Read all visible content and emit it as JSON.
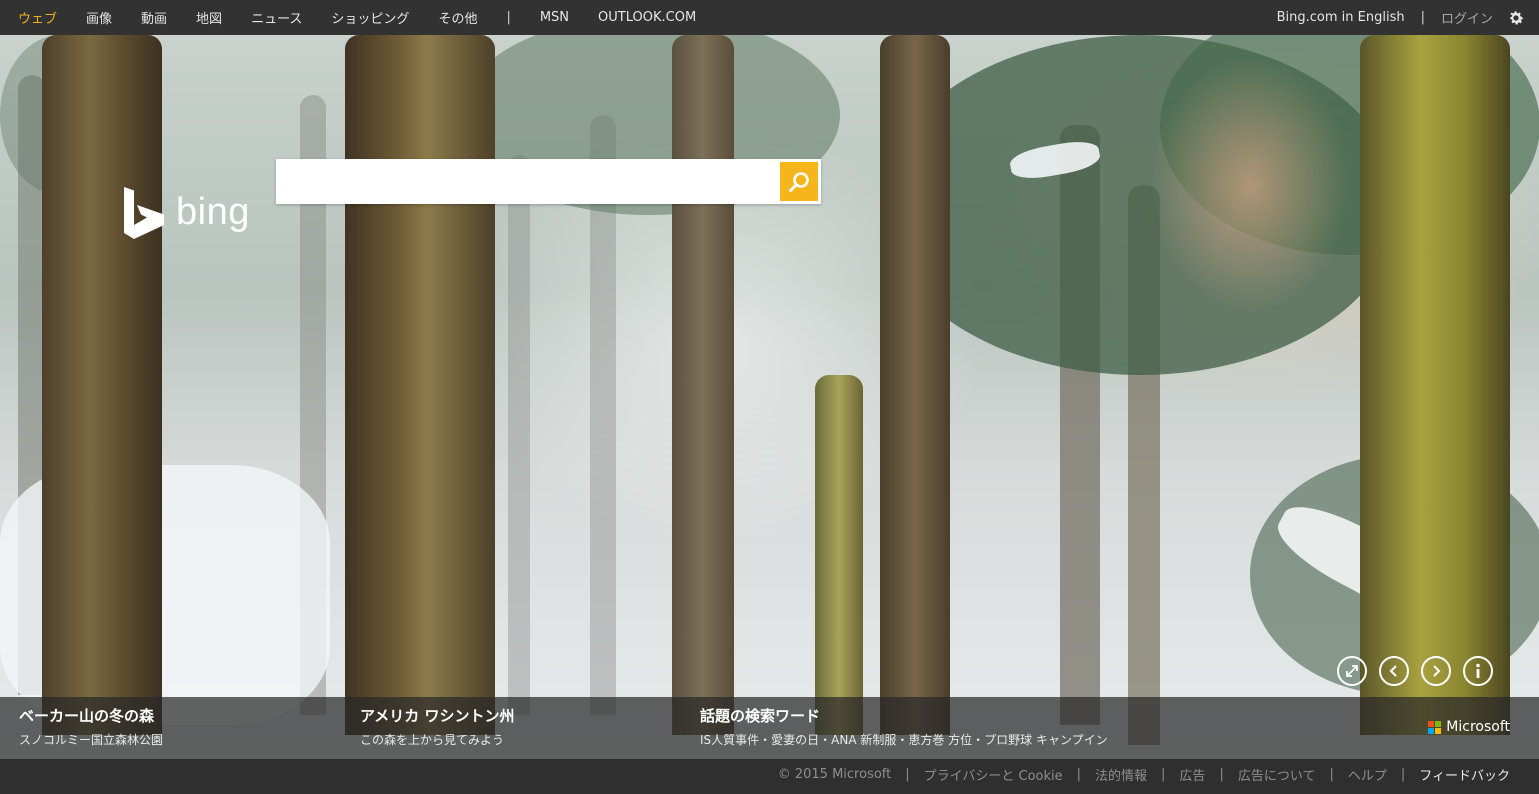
{
  "topnav": {
    "items": [
      {
        "label": "ウェブ",
        "active": true
      },
      {
        "label": "画像"
      },
      {
        "label": "動画"
      },
      {
        "label": "地図"
      },
      {
        "label": "ニュース"
      },
      {
        "label": "ショッピング"
      },
      {
        "label": "その他"
      }
    ],
    "separator": "|",
    "extra": [
      {
        "label": "MSN"
      },
      {
        "label": "OUTLOOK.COM"
      }
    ],
    "english_link": "Bing.com in English",
    "login": "ログイン",
    "settings_icon": "gear-icon"
  },
  "logo": {
    "wordmark": "bing",
    "icon": "bing-logo-icon"
  },
  "search": {
    "value": "",
    "placeholder": "",
    "button_icon": "search-icon"
  },
  "image_controls": [
    {
      "name": "fullscreen-icon"
    },
    {
      "name": "previous-icon"
    },
    {
      "name": "next-icon"
    },
    {
      "name": "info-icon"
    }
  ],
  "captions": {
    "image": {
      "title": "ベーカー山の冬の森",
      "subtitle": "スノコルミー国立森林公園"
    },
    "location": {
      "title": "アメリカ ワシントン州",
      "subtitle": "この森を上から見てみよう"
    },
    "trending": {
      "title": "話題の検索ワード",
      "subtitle": "IS人質事件・愛妻の日・ANA 新制服・恵方巻 方位・プロ野球 キャンプイン"
    }
  },
  "microsoft_label": "Microsoft",
  "colors": {
    "accent": "#f7b51c",
    "active_tab": "#f2b01e",
    "topbar": "#323232"
  },
  "footer": {
    "copyright": "© 2015 Microsoft",
    "links": [
      "プライバシーと Cookie",
      "法的情報",
      "広告",
      "広告について",
      "ヘルプ"
    ],
    "feedback": "フィードバック",
    "separator": "|"
  }
}
